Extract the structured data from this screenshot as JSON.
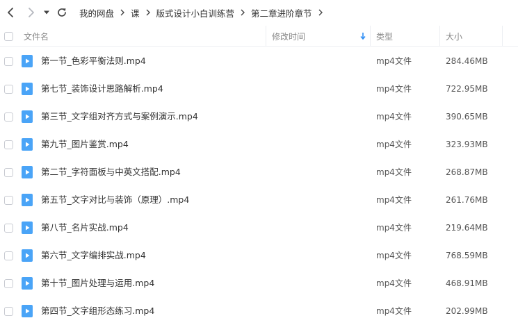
{
  "breadcrumb": [
    "我的网盘",
    "课",
    "版式设计小白训练营",
    "第二章进阶章节"
  ],
  "columns": {
    "name": "文件名",
    "modified": "修改时间",
    "type": "类型",
    "size": "大小"
  },
  "colors": {
    "accent": "#2e8ef5",
    "file_icon": "#4aa4f7"
  },
  "files": [
    {
      "name": "第一节_色彩平衡法则.mp4",
      "type": "mp4文件",
      "size": "284.46MB"
    },
    {
      "name": "第七节_装饰设计思路解析.mp4",
      "type": "mp4文件",
      "size": "722.95MB"
    },
    {
      "name": "第三节_文字组对齐方式与案例演示.mp4",
      "type": "mp4文件",
      "size": "390.65MB"
    },
    {
      "name": "第九节_图片鉴赏.mp4",
      "type": "mp4文件",
      "size": "323.93MB"
    },
    {
      "name": "第二节_字符面板与中英文搭配.mp4",
      "type": "mp4文件",
      "size": "268.87MB"
    },
    {
      "name": "第五节_文字对比与装饰（原理）.mp4",
      "type": "mp4文件",
      "size": "261.76MB"
    },
    {
      "name": "第八节_名片实战.mp4",
      "type": "mp4文件",
      "size": "219.64MB"
    },
    {
      "name": "第六节_文字编排实战.mp4",
      "type": "mp4文件",
      "size": "768.59MB"
    },
    {
      "name": "第十节_图片处理与运用.mp4",
      "type": "mp4文件",
      "size": "468.91MB"
    },
    {
      "name": "第四节_文字组形态练习.mp4",
      "type": "mp4文件",
      "size": "202.99MB"
    }
  ]
}
